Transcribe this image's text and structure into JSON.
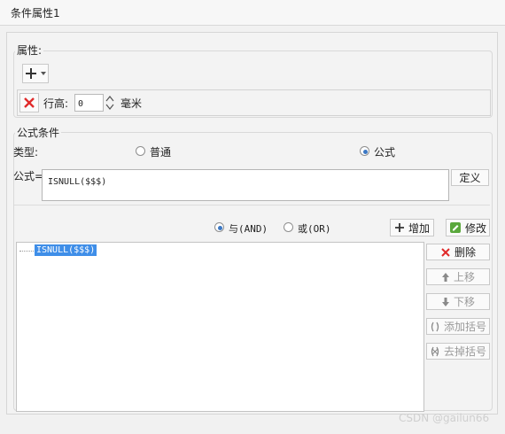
{
  "window": {
    "title": "条件属性1"
  },
  "attributes": {
    "legend": "属性:",
    "row_height_label": "行高:",
    "row_height_value": "0",
    "unit": "毫米"
  },
  "formula_conditions": {
    "legend": "公式条件",
    "type_label": "类型:",
    "type_options": [
      "普通",
      "公式"
    ],
    "selected_type": "公式",
    "formula_label": "公式=",
    "formula_value": "ISNULL($$$)",
    "define_button": "定义",
    "logic_options": [
      "与(AND)",
      "或(OR)"
    ],
    "selected_logic": "与(AND)",
    "add_button": "增加",
    "modify_button": "修改",
    "tree_items": [
      "ISNULL($$$)"
    ],
    "delete_button": "删除",
    "move_up_button": "上移",
    "move_down_button": "下移",
    "add_parens_button": "添加括号",
    "remove_parens_button": "去掉括号"
  },
  "watermark": "CSDN @gailun66"
}
